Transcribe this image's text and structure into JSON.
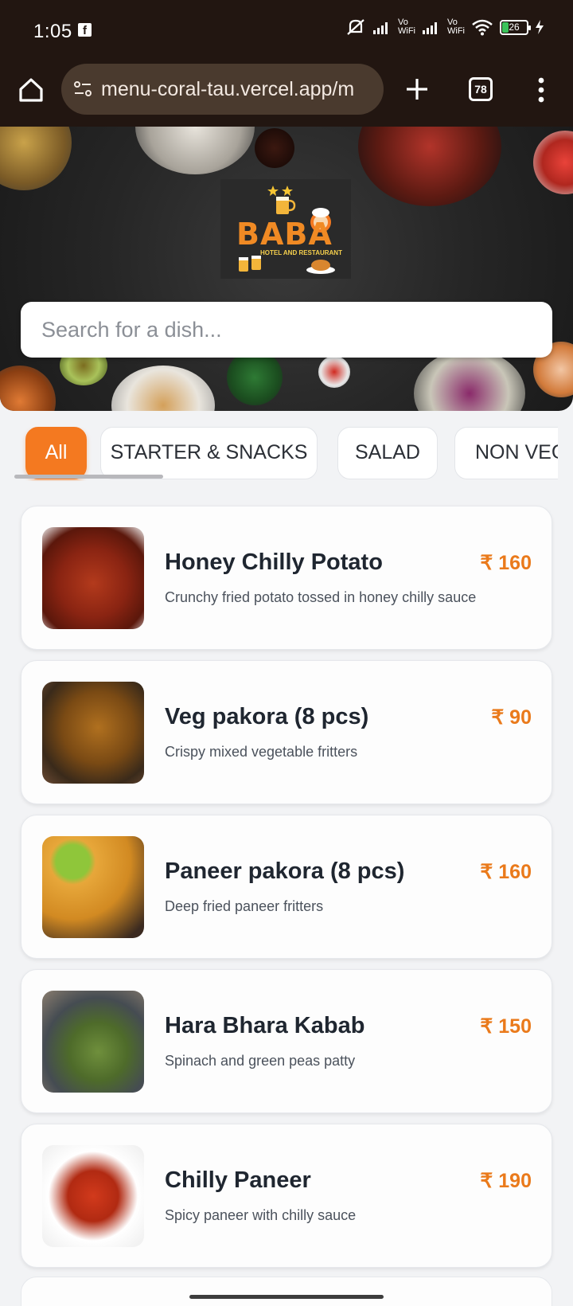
{
  "status_bar": {
    "time": "1:05",
    "app_icon": "facebook-icon",
    "vo_wifi_top": "Vo",
    "vo_wifi_bottom": "WiFi",
    "battery": "26"
  },
  "browser": {
    "url": "menu-coral-tau.vercel.app/m",
    "tab_count": "78"
  },
  "logo": {
    "name": "BABA",
    "tagline": "HOTEL AND RESTAURANT"
  },
  "search": {
    "placeholder": "Search for a dish..."
  },
  "categories": [
    "All",
    "STARTER & SNACKS",
    "SALAD",
    "NON VEG"
  ],
  "active_category": "All",
  "menu_items": [
    {
      "name": "Honey Chilly Potato",
      "price": "₹ 160",
      "description": "Crunchy fried potato tossed in honey chilly sauce"
    },
    {
      "name": "Veg pakora (8 pcs)",
      "price": "₹ 90",
      "description": "Crispy mixed vegetable fritters"
    },
    {
      "name": "Paneer pakora (8 pcs)",
      "price": "₹ 160",
      "description": "Deep fried paneer fritters"
    },
    {
      "name": "Hara Bhara Kabab",
      "price": "₹ 150",
      "description": "Spinach and green peas patty"
    },
    {
      "name": "Chilly Paneer",
      "price": "₹ 190",
      "description": "Spicy paneer with chilly sauce"
    }
  ],
  "colors": {
    "accent": "#f47920",
    "price": "#ea7a1b",
    "browser_bar": "#221611"
  }
}
